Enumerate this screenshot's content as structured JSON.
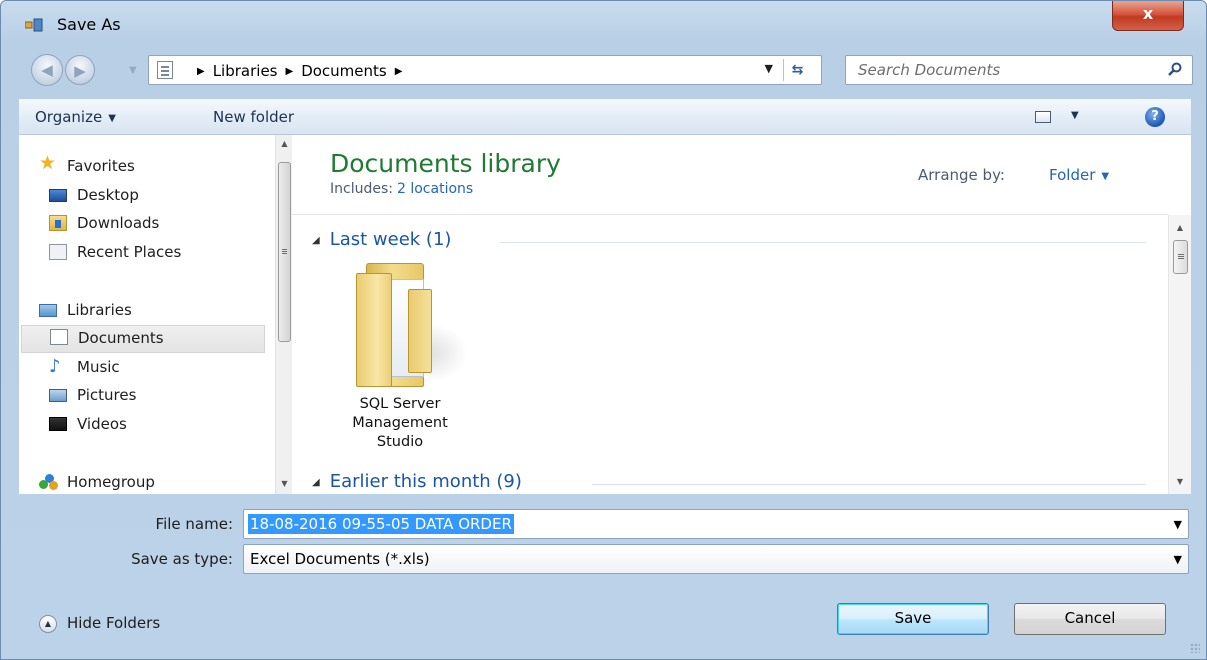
{
  "window": {
    "title": "Save As",
    "close_label": "x"
  },
  "address": {
    "crumbs": [
      "Libraries",
      "Documents"
    ],
    "search_placeholder": "Search Documents"
  },
  "toolbar": {
    "organize_label": "Organize",
    "new_folder_label": "New folder"
  },
  "nav": {
    "favorites": "Favorites",
    "desktop": "Desktop",
    "downloads": "Downloads",
    "recent_places": "Recent Places",
    "libraries": "Libraries",
    "documents": "Documents",
    "music": "Music",
    "pictures": "Pictures",
    "videos": "Videos",
    "homegroup": "Homegroup"
  },
  "library": {
    "title": "Documents library",
    "includes_label": "Includes:",
    "includes_link": "2 locations",
    "arrange_label": "Arrange by:",
    "arrange_value": "Folder"
  },
  "groups": [
    {
      "label": "Last week (1)"
    },
    {
      "label": "Earlier this month (9)"
    }
  ],
  "items": [
    {
      "name_line1": "SQL Server",
      "name_line2": "Management",
      "name_line3": "Studio"
    }
  ],
  "form": {
    "file_name_label": "File name:",
    "file_name_value": "18-08-2016 09-55-05 DATA ORDER",
    "save_type_label": "Save as type:",
    "save_type_value": "Excel Documents (*.xls)"
  },
  "footer": {
    "hide_folders_label": "Hide Folders",
    "save_label": "Save",
    "cancel_label": "Cancel"
  },
  "colors": {
    "library_title": "#1f7a33",
    "link_blue": "#2566b5",
    "selection": "#3399ff",
    "close_red": "#c13a20"
  }
}
